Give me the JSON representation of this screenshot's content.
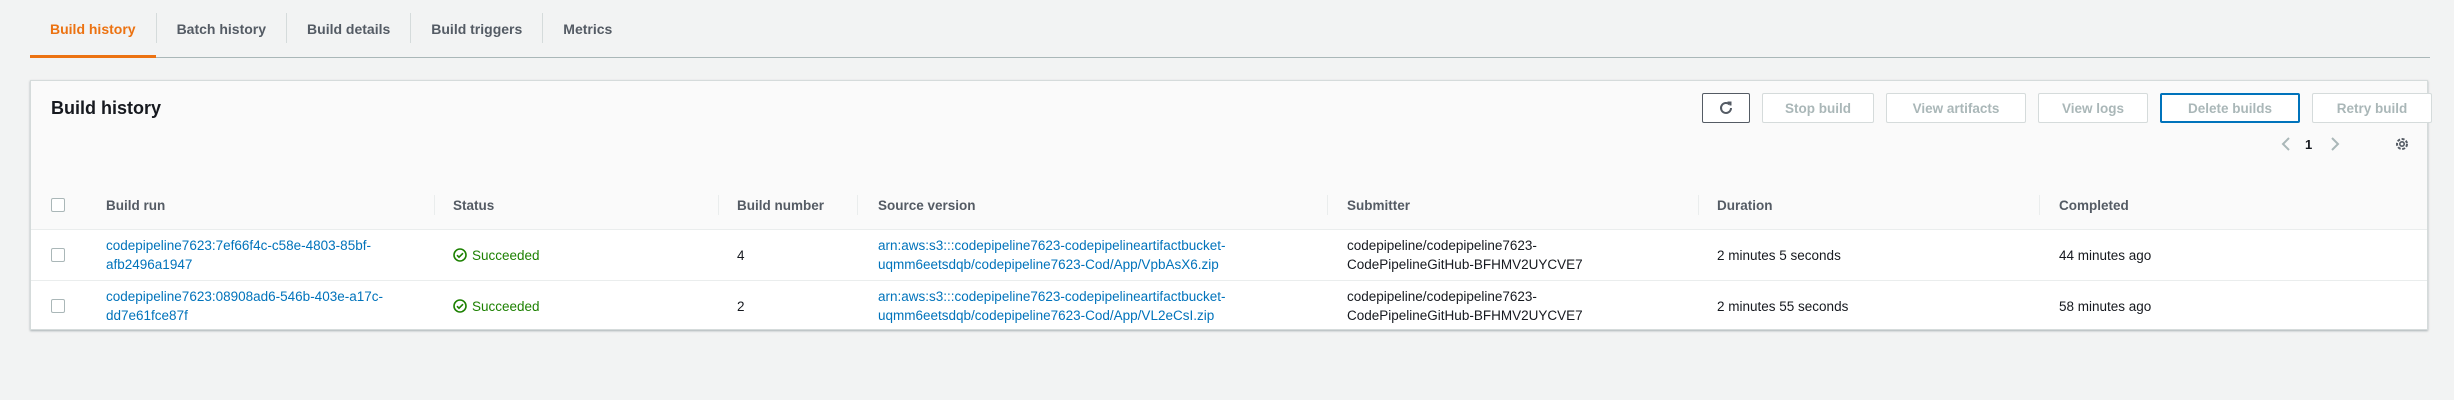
{
  "tabs": [
    {
      "label": "Build history",
      "active": true
    },
    {
      "label": "Batch history",
      "active": false
    },
    {
      "label": "Build details",
      "active": false
    },
    {
      "label": "Build triggers",
      "active": false
    },
    {
      "label": "Metrics",
      "active": false
    }
  ],
  "panel": {
    "title": "Build history",
    "actions": {
      "refresh_icon": "refresh-icon",
      "stop": "Stop build",
      "view_artifacts": "View artifacts",
      "view_logs": "View logs",
      "delete": "Delete builds",
      "retry": "Retry build"
    },
    "pagination": {
      "current_page": "1"
    }
  },
  "table": {
    "columns": [
      "Build run",
      "Status",
      "Build number",
      "Source version",
      "Submitter",
      "Duration",
      "Completed"
    ],
    "rows": [
      {
        "build_run": [
          "codepipeline7623:7ef66f4c-c58e-4803-85bf-",
          "afb2496a1947"
        ],
        "status": "Succeeded",
        "build_number": "4",
        "source_version": [
          "arn:aws:s3:::codepipeline7623-codepipelineartifactbucket-",
          "uqmm6eetsdqb/codepipeline7623-Cod/App/VpbAsX6.zip"
        ],
        "submitter": [
          "codepipeline/codepipeline7623-",
          "CodePipelineGitHub-BFHMV2UYCVE7"
        ],
        "duration": "2 minutes 5 seconds",
        "completed": "44 minutes ago"
      },
      {
        "build_run": [
          "codepipeline7623:08908ad6-546b-403e-a17c-",
          "dd7e61fce87f"
        ],
        "status": "Succeeded",
        "build_number": "2",
        "source_version": [
          "arn:aws:s3:::codepipeline7623-codepipelineartifactbucket-",
          "uqmm6eetsdqb/codepipeline7623-Cod/App/VL2eCsI.zip"
        ],
        "submitter": [
          "codepipeline/codepipeline7623-",
          "CodePipelineGitHub-BFHMV2UYCVE7"
        ],
        "duration": "2 minutes 55 seconds",
        "completed": "58 minutes ago"
      }
    ]
  },
  "colors": {
    "accent": "#ec7211",
    "link": "#0073bb",
    "success": "#1d8102"
  }
}
